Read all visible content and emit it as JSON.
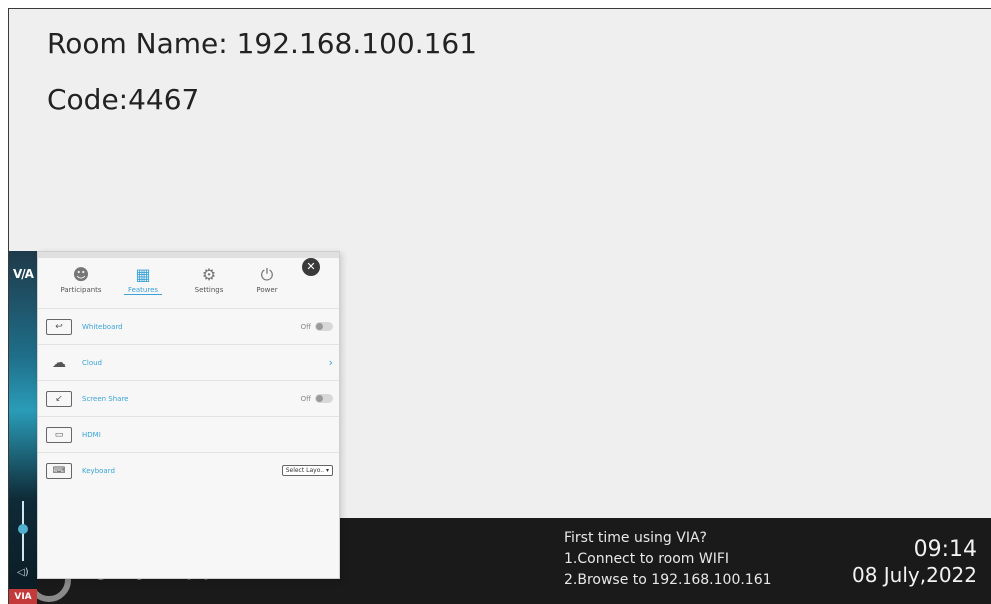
{
  "room": {
    "name_line": "Room Name: 192.168.100.161",
    "code_line": "Code:4467"
  },
  "bottom_bar": {
    "welcome_text": "me to VIA",
    "info_lines": [
      "First time using VIA?",
      "1.Connect to room WIFI",
      "2.Browse to 192.168.100.161"
    ],
    "time": "09:14",
    "date": "08 July,2022"
  },
  "strip": {
    "logo": "V/A",
    "foot_logo": "VIA"
  },
  "panel": {
    "tabs": [
      {
        "label": "Participants",
        "icon": "participants-icon"
      },
      {
        "label": "Features",
        "icon": "features-grid-icon",
        "active": true
      },
      {
        "label": "Settings",
        "icon": "gear-icon"
      },
      {
        "label": "Power",
        "icon": "power-icon"
      }
    ],
    "rows": [
      {
        "label": "Whiteboard",
        "icon": "whiteboard-icon",
        "state": "Off"
      },
      {
        "label": "Cloud",
        "icon": "cloud-icon"
      },
      {
        "label": "Screen Share",
        "icon": "screen-share-icon",
        "state": "Off"
      },
      {
        "label": "HDMI",
        "icon": "hdmi-icon"
      },
      {
        "label": "Keyboard",
        "icon": "keyboard-icon",
        "select": "Select Layo.."
      }
    ]
  },
  "colors": {
    "accent": "#3aa3d9",
    "bar_bg": "#1a1a1a",
    "screen_bg": "#efefef"
  }
}
